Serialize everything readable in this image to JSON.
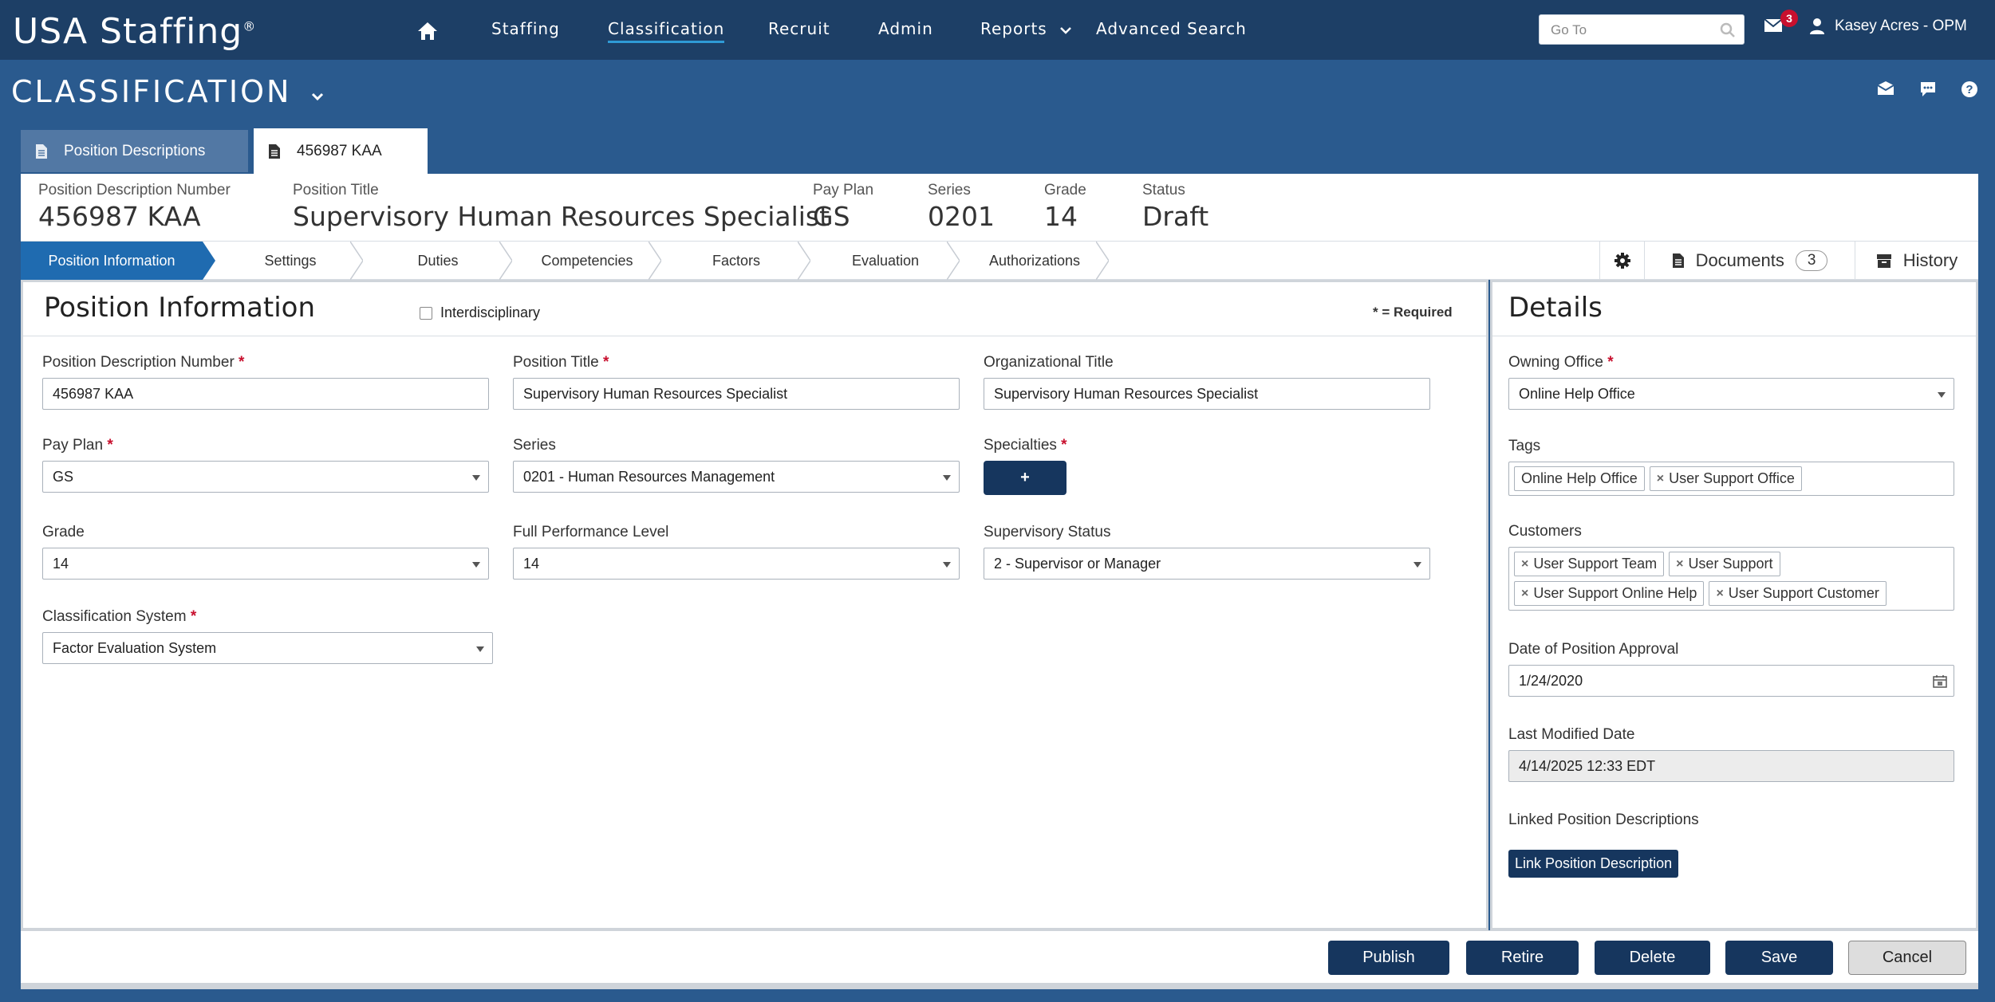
{
  "app": {
    "logo": "USA Staffing",
    "logo_mark": "®"
  },
  "nav": {
    "items": [
      "Staffing",
      "Classification",
      "Recruit",
      "Admin",
      "Reports",
      "Advanced Search"
    ],
    "active": "Classification",
    "goto_placeholder": "Go To",
    "mail_count": "3",
    "user": "Kasey Acres - OPM"
  },
  "section": {
    "title": "CLASSIFICATION"
  },
  "tabs": [
    {
      "label": "Position Descriptions"
    },
    {
      "label": "456987 KAA"
    }
  ],
  "pd_header": {
    "pd_number_label": "Position Description Number",
    "pd_number": "456987 KAA",
    "title_label": "Position Title",
    "title": "Supervisory Human Resources Specialist",
    "payplan_label": "Pay Plan",
    "payplan": "GS",
    "series_label": "Series",
    "series": "0201",
    "grade_label": "Grade",
    "grade": "14",
    "status_label": "Status",
    "status": "Draft"
  },
  "steps": [
    "Position Information",
    "Settings",
    "Duties",
    "Competencies",
    "Factors",
    "Evaluation",
    "Authorizations"
  ],
  "tools": {
    "documents_label": "Documents",
    "documents_count": "3",
    "history_label": "History"
  },
  "position_info": {
    "title": "Position Information",
    "interdisciplinary_label": "Interdisciplinary",
    "interdisciplinary_checked": false,
    "required_note": "* = Required",
    "fields": {
      "pd_number": {
        "label": "Position Description Number",
        "value": "456987 KAA"
      },
      "position_title": {
        "label": "Position Title",
        "value": "Supervisory Human Resources Specialist"
      },
      "org_title": {
        "label": "Organizational Title",
        "value": "Supervisory Human Resources Specialist"
      },
      "pay_plan": {
        "label": "Pay Plan",
        "value": "GS"
      },
      "series": {
        "label": "Series",
        "value": "0201 - Human Resources Management"
      },
      "specialties": {
        "label": "Specialties",
        "button": "+"
      },
      "grade": {
        "label": "Grade",
        "value": "14"
      },
      "fpl": {
        "label": "Full Performance Level",
        "value": "14"
      },
      "supervisory_status": {
        "label": "Supervisory Status",
        "value": "2 - Supervisor or Manager"
      },
      "classification_system": {
        "label": "Classification System",
        "value": "Factor Evaluation System"
      }
    }
  },
  "details": {
    "title": "Details",
    "owning_office": {
      "label": "Owning Office",
      "value": "Online Help Office"
    },
    "tags": {
      "label": "Tags",
      "items": [
        "Online Help Office",
        "User Support Office"
      ]
    },
    "customers": {
      "label": "Customers",
      "items": [
        "User Support Team",
        "User Support",
        "User Support Online Help",
        "User Support Customer"
      ]
    },
    "approval_date": {
      "label": "Date of Position Approval",
      "value": "1/24/2020"
    },
    "last_modified": {
      "label": "Last Modified Date",
      "value": "4/14/2025 12:33 EDT"
    },
    "linked": {
      "label": "Linked Position Descriptions",
      "button": "Link Position Description"
    }
  },
  "footer": {
    "publish": "Publish",
    "retire": "Retire",
    "delete": "Delete",
    "save": "Save",
    "cancel": "Cancel"
  },
  "colors": {
    "nav_bg": "#1d3f66",
    "page_bg": "#2a5a8e",
    "accent": "#1f6bb0",
    "button_bg": "#16365e",
    "required": "#c8102e"
  }
}
